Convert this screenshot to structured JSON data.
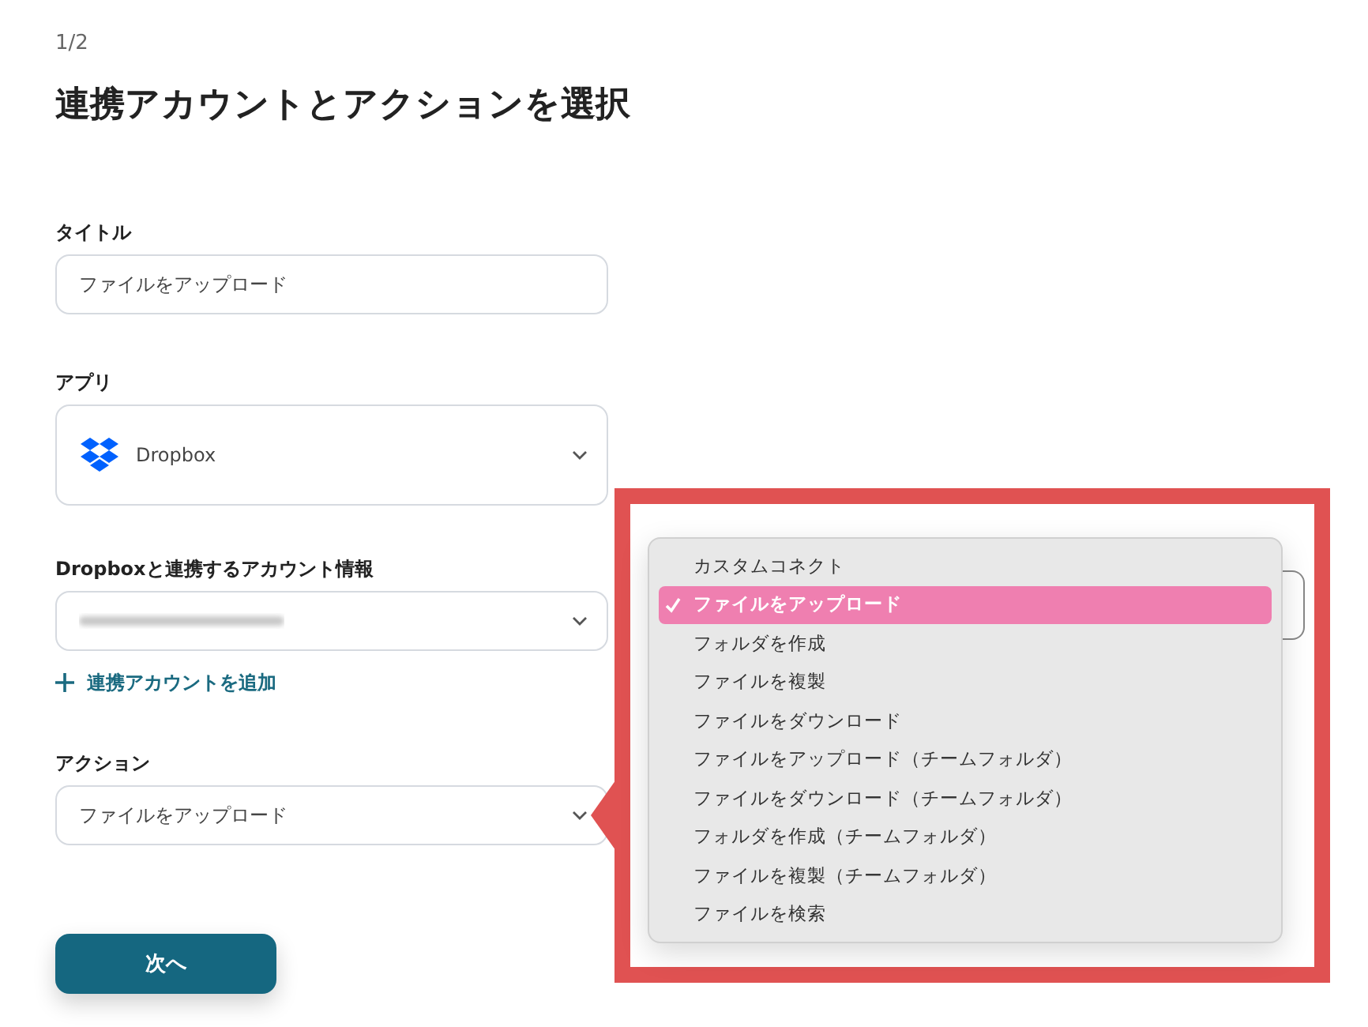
{
  "step": "1/2",
  "heading": "連携アカウントとアクションを選択",
  "fields": [
    {
      "kind": "text",
      "label": "タイトル",
      "value": "ファイルをアップロード"
    },
    {
      "kind": "app",
      "label": "アプリ",
      "value": "Dropbox"
    },
    {
      "kind": "account",
      "label": "Dropboxと連携するアカウント情報",
      "link": "連携アカウントを追加"
    },
    {
      "kind": "select",
      "label": "アクション",
      "value": "ファイルをアップロード"
    }
  ],
  "next_button": "次へ",
  "callout": {
    "menu": [
      {
        "label": "カスタムコネクト",
        "selected": false
      },
      {
        "label": "ファイルをアップロード",
        "selected": true
      },
      {
        "label": "フォルダを作成",
        "selected": false
      },
      {
        "label": "ファイルを複製",
        "selected": false
      },
      {
        "label": "ファイルをダウンロード",
        "selected": false
      },
      {
        "label": "ファイルをアップロード（チームフォルダ）",
        "selected": false
      },
      {
        "label": "ファイルをダウンロード（チームフォルダ）",
        "selected": false
      },
      {
        "label": "フォルダを作成（チームフォルダ）",
        "selected": false
      },
      {
        "label": "ファイルを複製（チームフォルダ）",
        "selected": false
      },
      {
        "label": "ファイルを検索",
        "selected": false
      }
    ]
  }
}
